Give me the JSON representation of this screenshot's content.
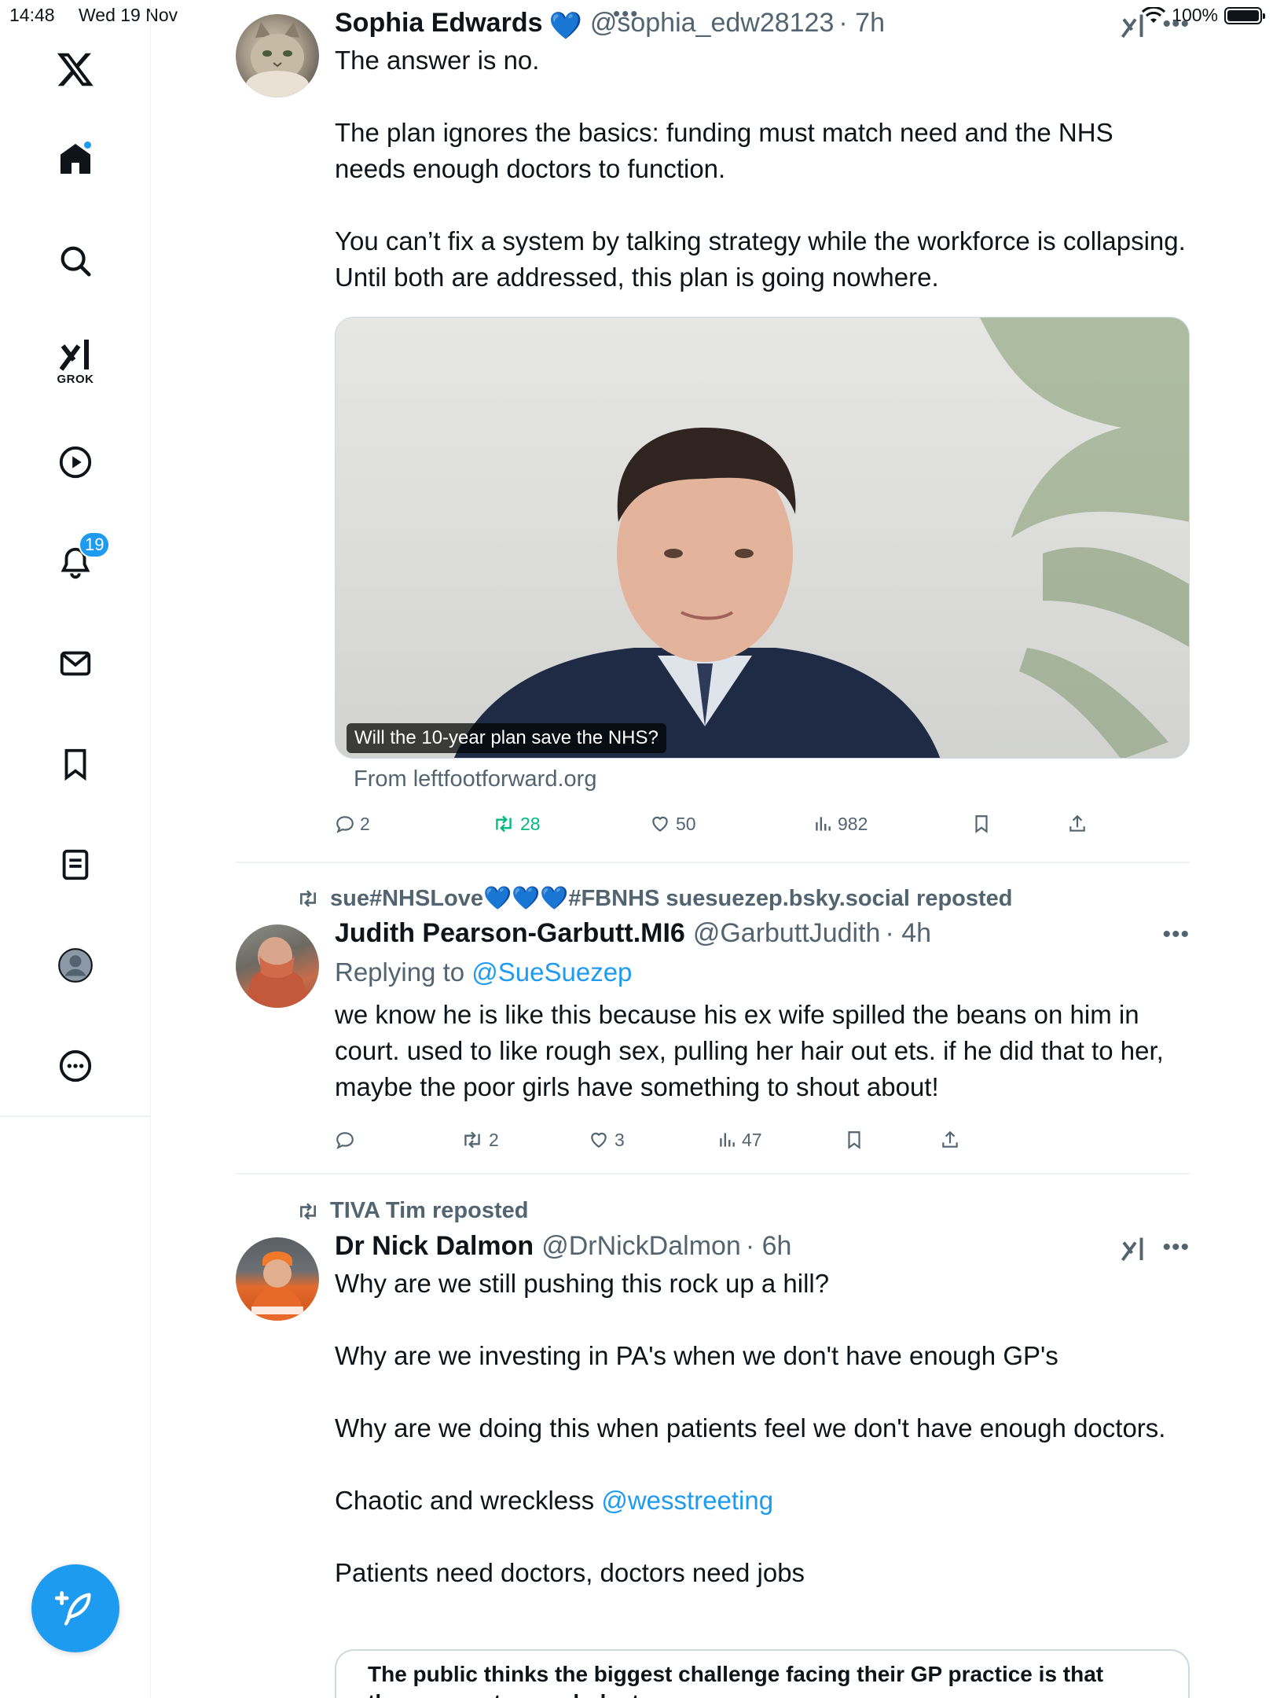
{
  "status_bar": {
    "time": "14:48",
    "date": "Wed 19 Nov",
    "battery": "100%"
  },
  "sidebar": {
    "items": [
      {
        "name": "x-logo-icon"
      },
      {
        "name": "home-icon"
      },
      {
        "name": "search-icon"
      },
      {
        "name": "grok-icon",
        "label": "GROK"
      },
      {
        "name": "video-icon"
      },
      {
        "name": "notifications-icon",
        "badge": "19"
      },
      {
        "name": "messages-icon"
      },
      {
        "name": "bookmarks-icon"
      },
      {
        "name": "lists-icon"
      },
      {
        "name": "profile-icon"
      },
      {
        "name": "more-icon"
      }
    ],
    "compose_icon": "compose-icon"
  },
  "posts": [
    {
      "author": "Sophia Edwards",
      "verified_emoji": "💙",
      "handle": "@sophia_edw28123",
      "time": "· 7h",
      "text": "The answer is no.\n\nThe plan ignores the basics: funding must match need and the NHS needs enough doctors to function.\n\nYou can’t fix a system by talking strategy while the workforce is collapsing. Until both are addressed, this plan is going nowhere.",
      "media_caption": "Will the 10-year plan save the NHS?",
      "media_source": "From leftfootforward.org",
      "replies": "2",
      "reposts": "28",
      "likes": "50",
      "views": "982"
    },
    {
      "reposted_by": "sue#NHSLove💙💙💙#FBNHS suesuezep.bsky.social reposted",
      "author": "Judith Pearson-Garbutt.MI6",
      "handle": "@GarbuttJudith",
      "time": "· 4h",
      "replying_prefix": "Replying to ",
      "replying_to": "@SueSuezep",
      "text": "we know he is like this because his ex wife spilled the beans on him in court. used to like rough sex, pulling her hair out ets. if he did that to her, maybe the poor girls have something to shout about!",
      "replies": "",
      "reposts": "2",
      "likes": "3",
      "views": "47"
    },
    {
      "reposted_by": "TIVA Tim reposted",
      "author": "Dr Nick Dalmon",
      "handle": "@DrNickDalmon",
      "time": "· 6h",
      "text_1": "Why are we still pushing this rock up a hill?\n\nWhy are we investing in PA's when we don't have enough GP's\n\nWhy are we doing this when patients feel we don't have enough doctors.\n\nChaotic and wreckless ",
      "mention": "@wesstreeting",
      "text_2": "\n\nPatients need doctors, doctors need jobs",
      "quote_text": "The public thinks the biggest challenge facing their GP practice is that there are not enough doctors"
    }
  ],
  "colors": {
    "accent": "#1d9bf0",
    "repost_green": "#00ba7c",
    "muted": "#536471",
    "text": "#0f1419"
  }
}
